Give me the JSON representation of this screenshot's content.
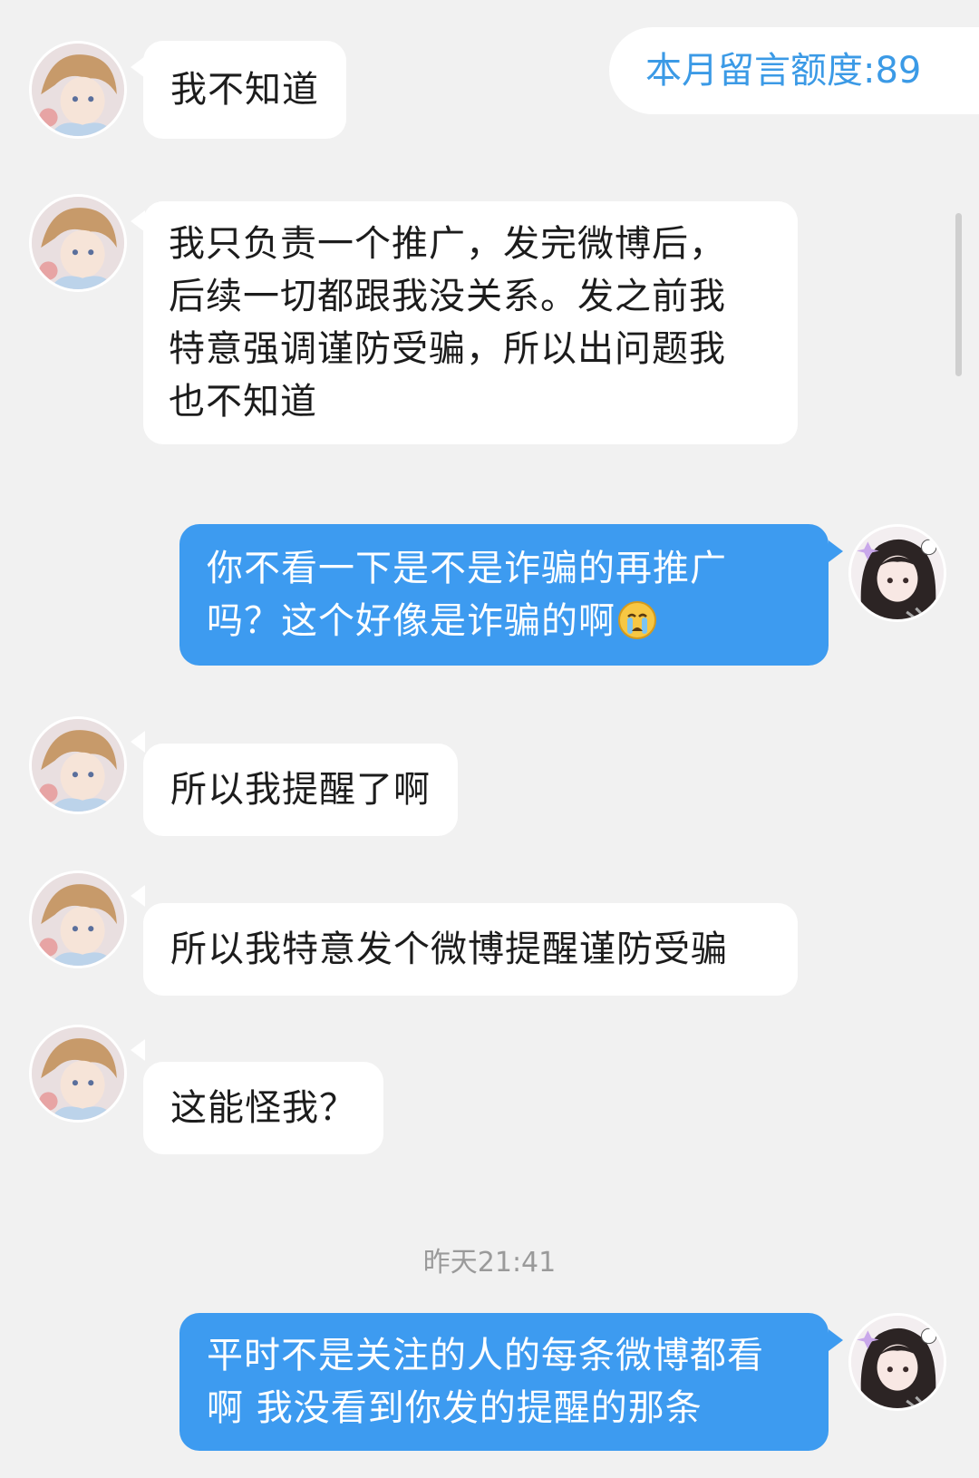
{
  "header": {
    "quota_text": "本月留言额度:89"
  },
  "messages": [
    {
      "side": "in",
      "lines": [
        "我不知道"
      ]
    },
    {
      "side": "in",
      "lines": [
        "我只负责一个推广，发完微博后，",
        "后续一切都跟我没关系。发之前我",
        "特意强调谨防受骗，所以出问题我",
        "也不知道"
      ]
    },
    {
      "side": "out",
      "lines": [
        "你不看一下是不是诈骗的再推广",
        "吗？这个好像是诈骗的啊"
      ],
      "emoji": "crying-face"
    },
    {
      "side": "in",
      "lines": [
        "所以我提醒了啊"
      ]
    },
    {
      "side": "in",
      "lines": [
        "所以我特意发个微博提醒谨防受骗"
      ]
    },
    {
      "side": "in",
      "lines": [
        "这能怪我？"
      ]
    },
    {
      "side": "out",
      "lines": [
        "平时不是关注的人的每条微博都看",
        "啊 我没看到你发的提醒的那条"
      ]
    }
  ],
  "timestamp": "昨天21:41",
  "colors": {
    "background": "#f1f1f1",
    "incoming_bubble": "#ffffff",
    "outgoing_bubble": "#3d9bf0",
    "quota_text": "#3b9ae6"
  }
}
